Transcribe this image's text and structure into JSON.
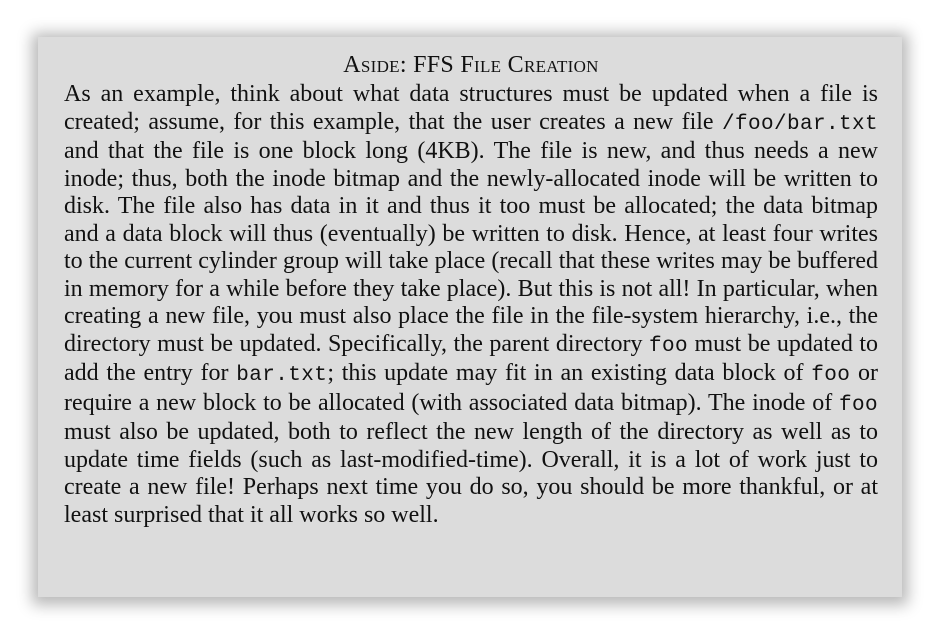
{
  "aside": {
    "title": "Aside: FFS File Creation",
    "segments": [
      {
        "text": "As an example, think about what data structures must be updated when a file is created; assume, for this example, that the user creates a new file ",
        "code": false
      },
      {
        "text": "/foo/bar.txt",
        "code": true
      },
      {
        "text": " and that the file is one block long (4KB). The file is new, and thus needs a new inode; thus, both the inode bitmap and the newly-allocated inode will be written to disk.  The file also has data in it and thus it too must be allocated; the data bitmap and a data block will thus (eventually) be written to disk. Hence, at least four writes to the current cylinder group will take place (recall that these writes may be buffered in memory for a while before they take place).  But this is not all!  In particular, when creating a new file, you must also place the file in the file-system hierarchy, i.e., the directory must be updated. Specifically, the parent directory ",
        "code": false
      },
      {
        "text": "foo",
        "code": true
      },
      {
        "text": " must be updated to add the entry for ",
        "code": false
      },
      {
        "text": "bar.txt",
        "code": true
      },
      {
        "text": "; this update may fit in an existing data block of ",
        "code": false
      },
      {
        "text": "foo",
        "code": true
      },
      {
        "text": " or require a new block to be allocated (with associated data bitmap).  The inode of ",
        "code": false
      },
      {
        "text": "foo",
        "code": true
      },
      {
        "text": " must also be updated, both to reflect the new length of the directory as well as to update time fields (such as last-modified-time). Overall, it is a lot of work just to create a new file! Perhaps next time you do so, you should be more thankful, or at least surprised that it all works so well.",
        "code": false
      }
    ]
  }
}
